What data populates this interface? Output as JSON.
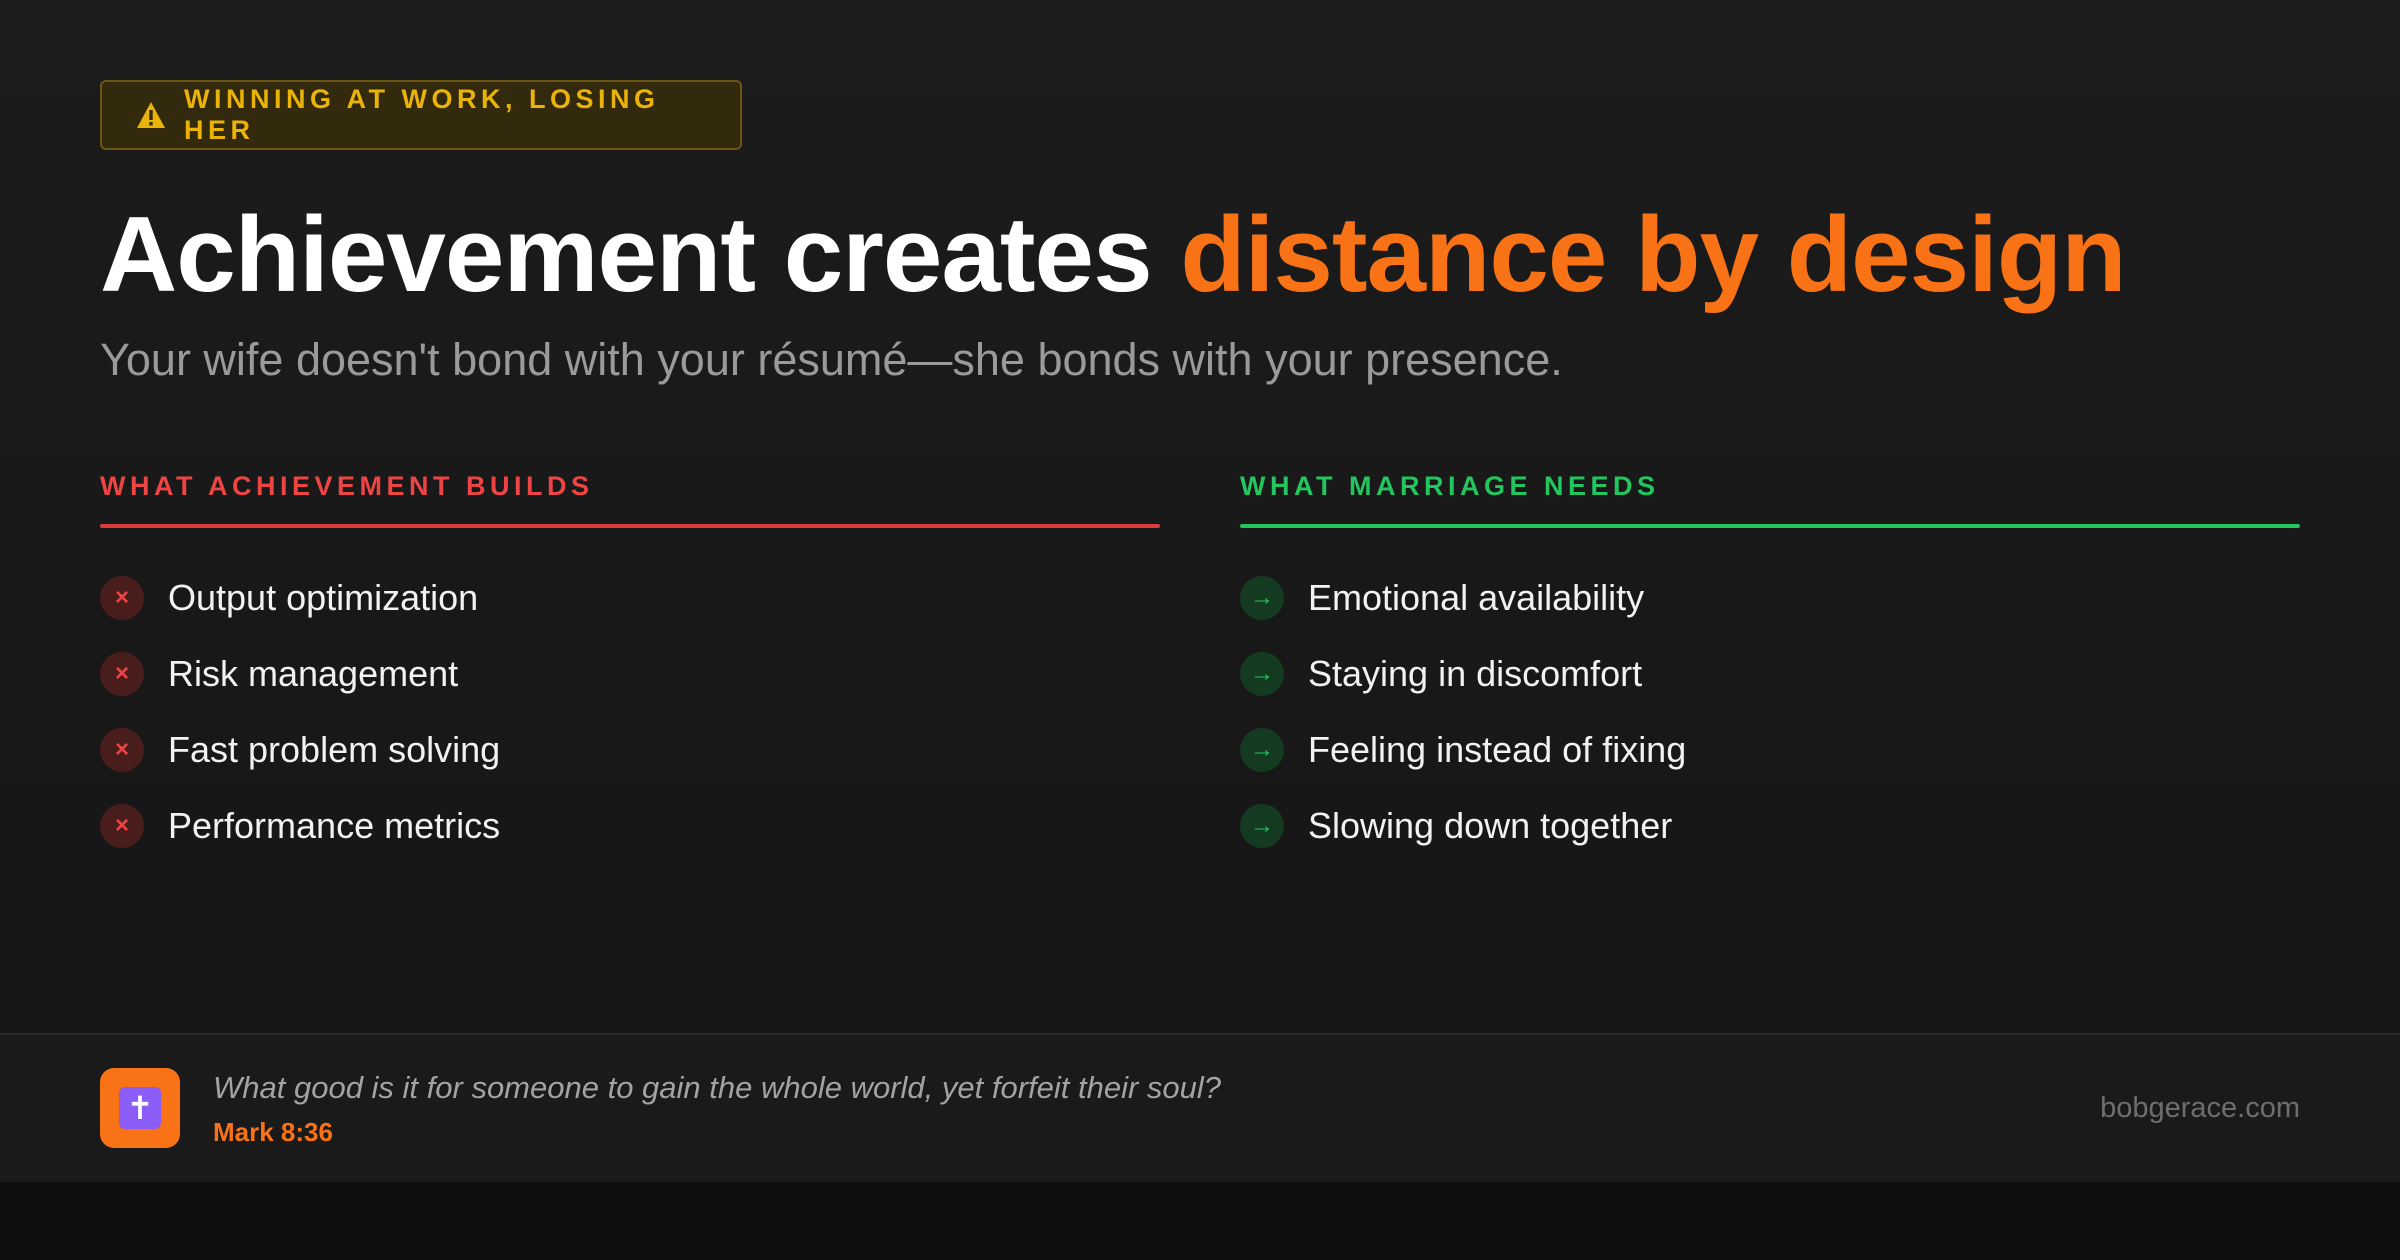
{
  "tag": {
    "icon": "warning-triangle-icon",
    "label": "WINNING AT WORK, LOSING HER",
    "color": "#eab308"
  },
  "headline": {
    "plain": "Achievement creates",
    "accent": "distance by design",
    "accent_color": "#f97316"
  },
  "subtitle": "Your wife doesn't bond with your résumé—she bonds with your presence.",
  "left_column": {
    "title": "WHAT ACHIEVEMENT BUILDS",
    "color": "#ef4444",
    "icon": "x-mark-icon",
    "items": [
      {
        "label": "Output optimization",
        "marker": "×"
      },
      {
        "label": "Risk management",
        "marker": "×"
      },
      {
        "label": "Fast problem solving",
        "marker": "×"
      },
      {
        "label": "Performance metrics",
        "marker": "×"
      }
    ]
  },
  "right_column": {
    "title": "WHAT MARRIAGE NEEDS",
    "color": "#22c55e",
    "icon": "arrow-right-icon",
    "items": [
      {
        "label": "Emotional availability",
        "marker": "→"
      },
      {
        "label": "Staying in discomfort",
        "marker": "→"
      },
      {
        "label": "Feeling instead of fixing",
        "marker": "→"
      },
      {
        "label": "Slowing down together",
        "marker": "→"
      }
    ]
  },
  "footer": {
    "logo": {
      "icon": "cross-icon",
      "glyph": "✝"
    },
    "quote": "What good is it for someone to gain the whole world, yet forfeit their soul?",
    "reference": "Mark 8:36",
    "site": "bobgerace.com"
  }
}
